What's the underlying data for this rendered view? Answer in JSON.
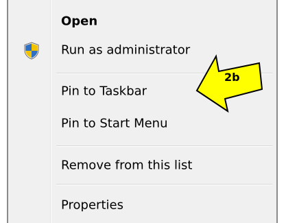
{
  "menu": {
    "items": [
      {
        "label": "Open",
        "bold": true
      },
      {
        "label": "Run as administrator",
        "icon": "uac-shield-icon"
      },
      {
        "label": "Pin to Taskbar"
      },
      {
        "label": "Pin to Start Menu"
      },
      {
        "label": "Remove from this list"
      },
      {
        "label": "Properties"
      }
    ]
  },
  "annotation": {
    "label": "2b",
    "color": "#ffff00"
  }
}
